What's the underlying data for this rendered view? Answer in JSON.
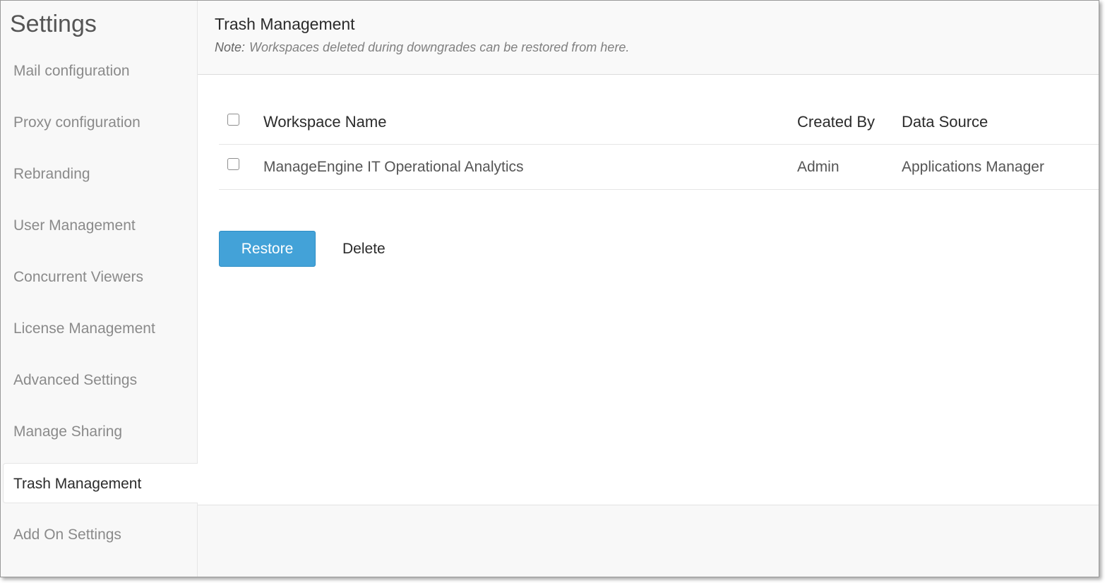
{
  "sidebar": {
    "title": "Settings",
    "items": [
      {
        "label": "Mail configuration"
      },
      {
        "label": "Proxy configuration"
      },
      {
        "label": "Rebranding"
      },
      {
        "label": "User Management"
      },
      {
        "label": "Concurrent Viewers"
      },
      {
        "label": "License Management"
      },
      {
        "label": "Advanced Settings"
      },
      {
        "label": "Manage Sharing"
      },
      {
        "label": "Trash Management",
        "active": true
      },
      {
        "label": "Add On Settings"
      }
    ]
  },
  "main": {
    "title": "Trash Management",
    "note_label": "Note:",
    "note_text": "Workspaces deleted during downgrades can be restored from here.",
    "table": {
      "columns": [
        "Workspace Name",
        "Created By",
        "Data Source"
      ],
      "rows": [
        {
          "workspace_name": "ManageEngine IT Operational Analytics",
          "created_by": "Admin",
          "data_source": "Applications Manager"
        }
      ]
    },
    "restore_label": "Restore",
    "delete_label": "Delete"
  },
  "colors": {
    "accent": "#43a2d8",
    "active_text": "#2b2b2b",
    "inactive_text": "#8a8a8a"
  }
}
